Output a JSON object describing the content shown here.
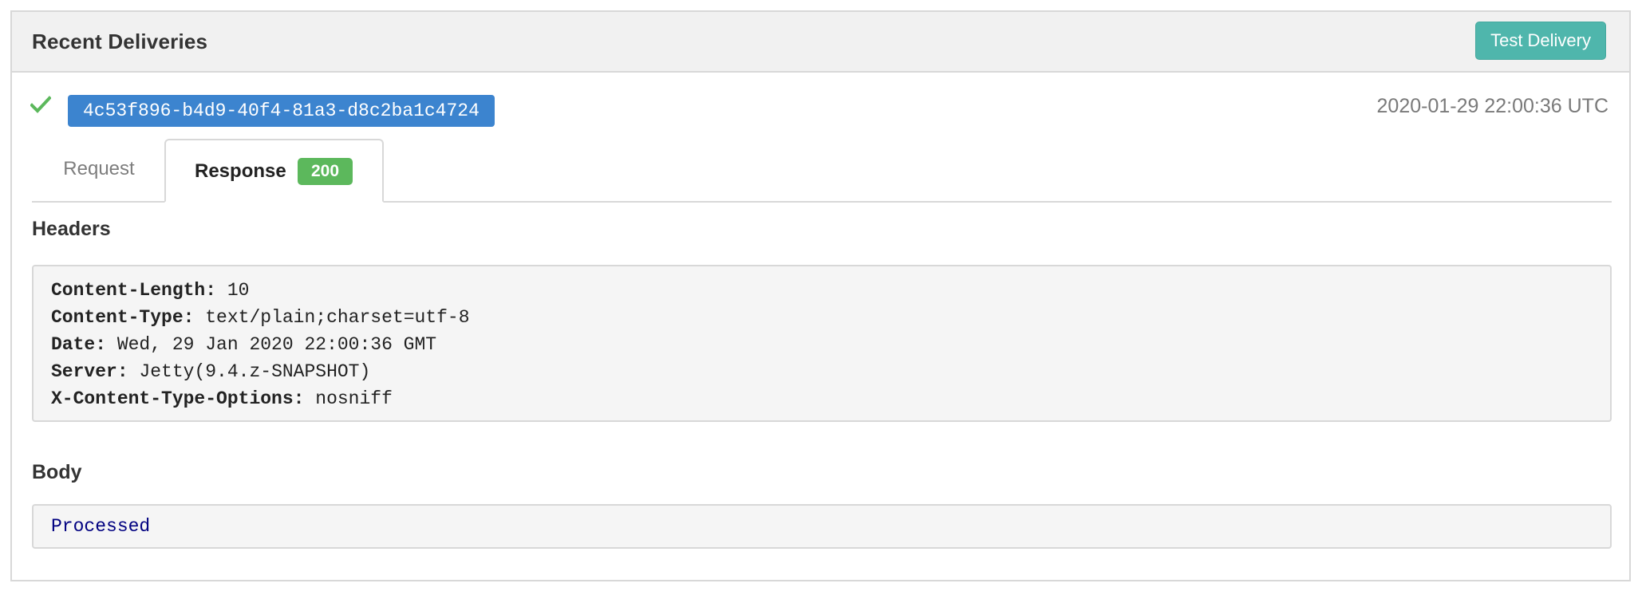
{
  "panel": {
    "title": "Recent Deliveries",
    "test_button_label": "Test Delivery"
  },
  "delivery": {
    "status_icon": "check-icon",
    "id": "4c53f896-b4d9-40f4-81a3-d8c2ba1c4724",
    "timestamp": "2020-01-29 22:00:36 UTC"
  },
  "tabs": {
    "request_label": "Request",
    "response_label": "Response",
    "response_status": "200",
    "active": "Response"
  },
  "headers": {
    "title": "Headers",
    "items": [
      {
        "key": "Content-Length:",
        "value": "10"
      },
      {
        "key": "Content-Type:",
        "value": "text/plain;charset=utf-8"
      },
      {
        "key": "Date:",
        "value": "Wed, 29 Jan 2020 22:00:36 GMT"
      },
      {
        "key": "Server:",
        "value": "Jetty(9.4.z-SNAPSHOT)"
      },
      {
        "key": "X-Content-Type-Options:",
        "value": "nosniff"
      }
    ]
  },
  "body": {
    "title": "Body",
    "content": "Processed"
  },
  "colors": {
    "accent_teal": "#4fb6ac",
    "id_badge_blue": "#3c84cf",
    "success_green": "#5cb85c",
    "body_text_navy": "#000080"
  }
}
